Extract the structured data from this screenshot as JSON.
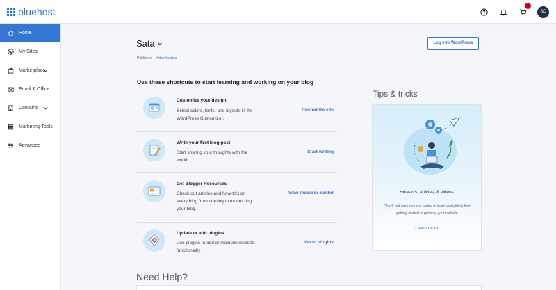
{
  "brand": {
    "name": "bluehost",
    "accent": "#3575d3"
  },
  "topbar": {
    "icons": [
      "help-icon",
      "bell-icon",
      "cart-icon"
    ],
    "cart_badge": "1",
    "avatar_initials": "SC"
  },
  "sidebar": {
    "items": [
      {
        "label": "Home",
        "icon": "home-icon",
        "active": true
      },
      {
        "label": "My Sites",
        "icon": "wordpress-icon"
      },
      {
        "label": "Marketplace",
        "icon": "store-icon",
        "expandable": true
      },
      {
        "label": "Email & Office",
        "icon": "mail-icon"
      },
      {
        "label": "Domains",
        "icon": "building-icon",
        "expandable": true
      },
      {
        "label": "Marketing Tools",
        "icon": "layers-icon"
      },
      {
        "label": "Advanced",
        "icon": "sliders-icon"
      }
    ]
  },
  "site": {
    "name": "Sata",
    "published_label": "Published",
    "url": "https://sata.al",
    "login_button": "Log into WordPress"
  },
  "shortcuts": {
    "heading": "Use these shortcuts to start learning and working on your blog",
    "items": [
      {
        "title": "Customize your design",
        "description": "Select colors, fonts, and layouts in the WordPress Customizer.",
        "link": "Customize site",
        "icon": "design-icon"
      },
      {
        "title": "Write your first blog post",
        "description": "Start sharing your thoughts with the world!",
        "link": "Start writing",
        "icon": "pencil-doc-icon"
      },
      {
        "title": "Get Blogger Resources",
        "description": "Check out articles and how-to's on everything from starting to monetizing your blog.",
        "link": "View resource center",
        "icon": "resources-icon"
      },
      {
        "title": "Update or add plugins",
        "description": "Use plugins to add or maintain website functionality",
        "link": "Go to plugins",
        "icon": "plugin-icon"
      }
    ]
  },
  "tips": {
    "heading": "Tips & tricks",
    "title": "How-to's, articles, & videos",
    "description": "Check out our resource center to learn everything from getting started to growing your website.",
    "link": "Learn more"
  },
  "help": {
    "heading": "Need Help?"
  }
}
